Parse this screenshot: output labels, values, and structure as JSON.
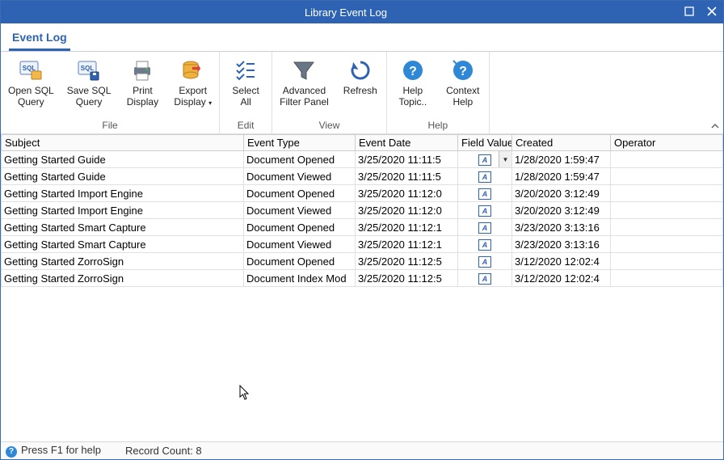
{
  "window": {
    "title": "Library Event Log"
  },
  "tabs": {
    "event_log": "Event Log"
  },
  "ribbon": {
    "groups": {
      "file": "File",
      "edit": "Edit",
      "view": "View",
      "help": "Help"
    },
    "buttons": {
      "open_sql_l1": "Open SQL",
      "open_sql_l2": "Query",
      "save_sql_l1": "Save SQL",
      "save_sql_l2": "Query",
      "print_l1": "Print",
      "print_l2": "Display",
      "export_l1": "Export",
      "export_l2": "Display ",
      "select_l1": "Select",
      "select_l2": "All",
      "adv_l1": "Advanced",
      "adv_l2": "Filter Panel",
      "refresh": "Refresh",
      "help_l1": "Help",
      "help_l2": "Topic..",
      "context_l1": "Context",
      "context_l2": "Help"
    }
  },
  "grid": {
    "headers": {
      "subject": "Subject",
      "event_type": "Event Type",
      "event_date": "Event Date",
      "field_values": "Field Values",
      "created": "Created",
      "operator": "Operator"
    },
    "rows": [
      {
        "subject": "Getting Started Guide",
        "event_type": "Document Opened",
        "event_date": "3/25/2020 11:11:5",
        "created": "1/28/2020 1:59:47",
        "operator": ""
      },
      {
        "subject": "Getting Started Guide",
        "event_type": "Document Viewed",
        "event_date": "3/25/2020 11:11:5",
        "created": "1/28/2020 1:59:47",
        "operator": ""
      },
      {
        "subject": "Getting Started Import Engine",
        "event_type": "Document Opened",
        "event_date": "3/25/2020 11:12:0",
        "created": "3/20/2020 3:12:49",
        "operator": ""
      },
      {
        "subject": "Getting Started Import Engine",
        "event_type": "Document Viewed",
        "event_date": "3/25/2020 11:12:0",
        "created": "3/20/2020 3:12:49",
        "operator": ""
      },
      {
        "subject": "Getting Started Smart Capture",
        "event_type": "Document Opened",
        "event_date": "3/25/2020 11:12:1",
        "created": "3/23/2020 3:13:16",
        "operator": ""
      },
      {
        "subject": "Getting Started Smart Capture",
        "event_type": "Document Viewed",
        "event_date": "3/25/2020 11:12:1",
        "created": "3/23/2020 3:13:16",
        "operator": ""
      },
      {
        "subject": "Getting Started ZorroSign",
        "event_type": "Document Opened",
        "event_date": "3/25/2020 11:12:5",
        "created": "3/12/2020 12:02:4",
        "operator": ""
      },
      {
        "subject": "Getting Started ZorroSign",
        "event_type": "Document Index Mod",
        "event_date": "3/25/2020 11:12:5",
        "created": "3/12/2020 12:02:4",
        "operator": ""
      }
    ]
  },
  "statusbar": {
    "help": "Press F1 for help",
    "count_label": "Record Count: 8"
  }
}
